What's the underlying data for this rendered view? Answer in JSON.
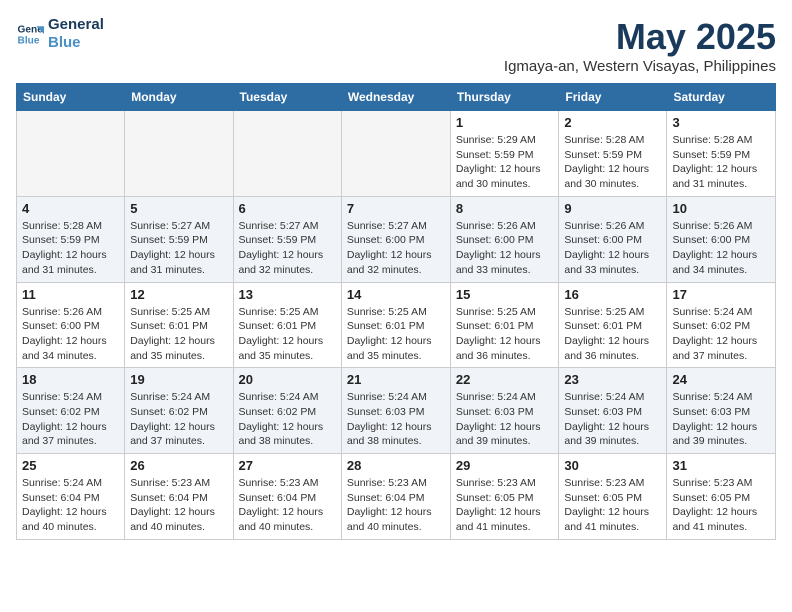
{
  "logo": {
    "line1": "General",
    "line2": "Blue"
  },
  "title": "May 2025",
  "location": "Igmaya-an, Western Visayas, Philippines",
  "weekdays": [
    "Sunday",
    "Monday",
    "Tuesday",
    "Wednesday",
    "Thursday",
    "Friday",
    "Saturday"
  ],
  "weeks": [
    [
      {
        "day": "",
        "info": ""
      },
      {
        "day": "",
        "info": ""
      },
      {
        "day": "",
        "info": ""
      },
      {
        "day": "",
        "info": ""
      },
      {
        "day": "1",
        "info": "Sunrise: 5:29 AM\nSunset: 5:59 PM\nDaylight: 12 hours\nand 30 minutes."
      },
      {
        "day": "2",
        "info": "Sunrise: 5:28 AM\nSunset: 5:59 PM\nDaylight: 12 hours\nand 30 minutes."
      },
      {
        "day": "3",
        "info": "Sunrise: 5:28 AM\nSunset: 5:59 PM\nDaylight: 12 hours\nand 31 minutes."
      }
    ],
    [
      {
        "day": "4",
        "info": "Sunrise: 5:28 AM\nSunset: 5:59 PM\nDaylight: 12 hours\nand 31 minutes."
      },
      {
        "day": "5",
        "info": "Sunrise: 5:27 AM\nSunset: 5:59 PM\nDaylight: 12 hours\nand 31 minutes."
      },
      {
        "day": "6",
        "info": "Sunrise: 5:27 AM\nSunset: 5:59 PM\nDaylight: 12 hours\nand 32 minutes."
      },
      {
        "day": "7",
        "info": "Sunrise: 5:27 AM\nSunset: 6:00 PM\nDaylight: 12 hours\nand 32 minutes."
      },
      {
        "day": "8",
        "info": "Sunrise: 5:26 AM\nSunset: 6:00 PM\nDaylight: 12 hours\nand 33 minutes."
      },
      {
        "day": "9",
        "info": "Sunrise: 5:26 AM\nSunset: 6:00 PM\nDaylight: 12 hours\nand 33 minutes."
      },
      {
        "day": "10",
        "info": "Sunrise: 5:26 AM\nSunset: 6:00 PM\nDaylight: 12 hours\nand 34 minutes."
      }
    ],
    [
      {
        "day": "11",
        "info": "Sunrise: 5:26 AM\nSunset: 6:00 PM\nDaylight: 12 hours\nand 34 minutes."
      },
      {
        "day": "12",
        "info": "Sunrise: 5:25 AM\nSunset: 6:01 PM\nDaylight: 12 hours\nand 35 minutes."
      },
      {
        "day": "13",
        "info": "Sunrise: 5:25 AM\nSunset: 6:01 PM\nDaylight: 12 hours\nand 35 minutes."
      },
      {
        "day": "14",
        "info": "Sunrise: 5:25 AM\nSunset: 6:01 PM\nDaylight: 12 hours\nand 35 minutes."
      },
      {
        "day": "15",
        "info": "Sunrise: 5:25 AM\nSunset: 6:01 PM\nDaylight: 12 hours\nand 36 minutes."
      },
      {
        "day": "16",
        "info": "Sunrise: 5:25 AM\nSunset: 6:01 PM\nDaylight: 12 hours\nand 36 minutes."
      },
      {
        "day": "17",
        "info": "Sunrise: 5:24 AM\nSunset: 6:02 PM\nDaylight: 12 hours\nand 37 minutes."
      }
    ],
    [
      {
        "day": "18",
        "info": "Sunrise: 5:24 AM\nSunset: 6:02 PM\nDaylight: 12 hours\nand 37 minutes."
      },
      {
        "day": "19",
        "info": "Sunrise: 5:24 AM\nSunset: 6:02 PM\nDaylight: 12 hours\nand 37 minutes."
      },
      {
        "day": "20",
        "info": "Sunrise: 5:24 AM\nSunset: 6:02 PM\nDaylight: 12 hours\nand 38 minutes."
      },
      {
        "day": "21",
        "info": "Sunrise: 5:24 AM\nSunset: 6:03 PM\nDaylight: 12 hours\nand 38 minutes."
      },
      {
        "day": "22",
        "info": "Sunrise: 5:24 AM\nSunset: 6:03 PM\nDaylight: 12 hours\nand 39 minutes."
      },
      {
        "day": "23",
        "info": "Sunrise: 5:24 AM\nSunset: 6:03 PM\nDaylight: 12 hours\nand 39 minutes."
      },
      {
        "day": "24",
        "info": "Sunrise: 5:24 AM\nSunset: 6:03 PM\nDaylight: 12 hours\nand 39 minutes."
      }
    ],
    [
      {
        "day": "25",
        "info": "Sunrise: 5:24 AM\nSunset: 6:04 PM\nDaylight: 12 hours\nand 40 minutes."
      },
      {
        "day": "26",
        "info": "Sunrise: 5:23 AM\nSunset: 6:04 PM\nDaylight: 12 hours\nand 40 minutes."
      },
      {
        "day": "27",
        "info": "Sunrise: 5:23 AM\nSunset: 6:04 PM\nDaylight: 12 hours\nand 40 minutes."
      },
      {
        "day": "28",
        "info": "Sunrise: 5:23 AM\nSunset: 6:04 PM\nDaylight: 12 hours\nand 40 minutes."
      },
      {
        "day": "29",
        "info": "Sunrise: 5:23 AM\nSunset: 6:05 PM\nDaylight: 12 hours\nand 41 minutes."
      },
      {
        "day": "30",
        "info": "Sunrise: 5:23 AM\nSunset: 6:05 PM\nDaylight: 12 hours\nand 41 minutes."
      },
      {
        "day": "31",
        "info": "Sunrise: 5:23 AM\nSunset: 6:05 PM\nDaylight: 12 hours\nand 41 minutes."
      }
    ]
  ]
}
